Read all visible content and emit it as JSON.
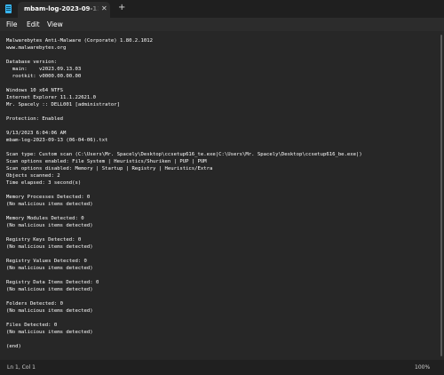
{
  "window": {
    "tab_title": "mbam-log-2023-09-13 (06-04-06).txt",
    "tab_close_icon": "close-icon",
    "new_tab_icon": "plus-icon",
    "app_icon": "notepad-icon"
  },
  "menu": {
    "items": [
      {
        "label": "File"
      },
      {
        "label": "Edit"
      },
      {
        "label": "View"
      }
    ]
  },
  "document": {
    "lines": [
      "Malwarebytes Anti-Malware (Corporate) 1.80.2.1012",
      "www.malwarebytes.org",
      "",
      "Database version:",
      "  main:    v2023.09.13.03",
      "  rootkit: v0000.00.00.00",
      "",
      "Windows 10 x64 NTFS",
      "Internet Explorer 11.1.22621.0",
      "Mr. Spacely :: DELL001 [administrator]",
      "",
      "Protection: Enabled",
      "",
      "9/13/2023 6:04:06 AM",
      "mbam-log-2023-09-13 (06-04-06).txt",
      "",
      "Scan type: Custom scan (C:\\Users\\Mr. Spacely\\Desktop\\ccsetup616_te.exe|C:\\Users\\Mr. Spacely\\Desktop\\ccsetup616_be.exe|)",
      "Scan options enabled: File System | Heuristics/Shuriken | PUP | PUM",
      "Scan options disabled: Memory | Startup | Registry | Heuristics/Extra",
      "Objects scanned: 2",
      "Time elapsed: 3 second(s)",
      "",
      "Memory Processes Detected: 0",
      "(No malicious items detected)",
      "",
      "Memory Modules Detected: 0",
      "(No malicious items detected)",
      "",
      "Registry Keys Detected: 0",
      "(No malicious items detected)",
      "",
      "Registry Values Detected: 0",
      "(No malicious items detected)",
      "",
      "Registry Data Items Detected: 0",
      "(No malicious items detected)",
      "",
      "Folders Detected: 0",
      "(No malicious items detected)",
      "",
      "Files Detected: 0",
      "(No malicious items detected)",
      "",
      "(end)"
    ]
  },
  "status": {
    "position": "Ln 1, Col 1",
    "zoom": "100%"
  },
  "colors": {
    "titlebar": "#1f1f1f",
    "menubar": "#2c2c2c",
    "editor_bg": "#272727",
    "statusbar": "#202020",
    "text": "#ffffff",
    "app_icon_accent": "#38b5f0"
  }
}
